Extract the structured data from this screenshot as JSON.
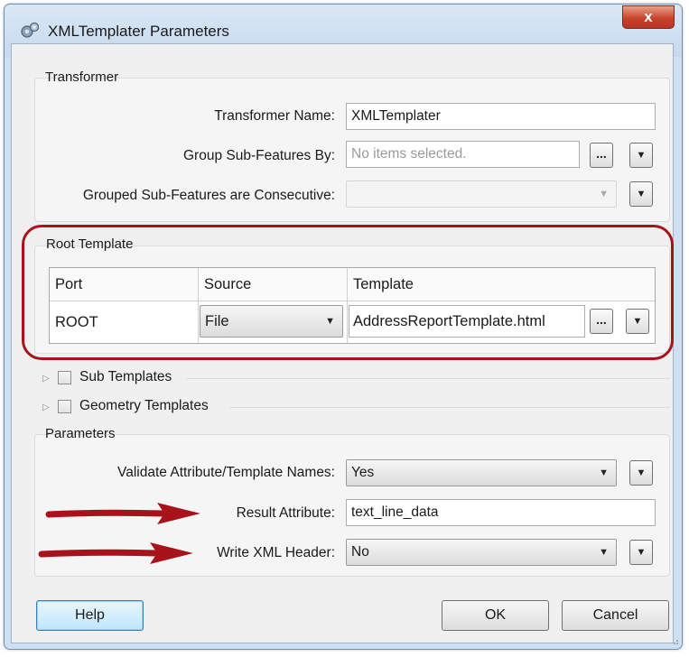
{
  "window": {
    "title": "XMLTemplater Parameters",
    "close_glyph": "x"
  },
  "transformer": {
    "group_title": "Transformer",
    "name_label": "Transformer Name:",
    "name_value": "XMLTemplater",
    "group_by_label": "Group Sub-Features By:",
    "group_by_placeholder": "No items selected.",
    "group_by_button": "...",
    "consecutive_label": "Grouped Sub-Features are Consecutive:",
    "consecutive_value": ""
  },
  "root_template": {
    "group_title": "Root Template",
    "columns": [
      "Port",
      "Source",
      "Template"
    ],
    "row": {
      "port": "ROOT",
      "source": "File",
      "template": "AddressReportTemplate.html",
      "browse_button": "..."
    }
  },
  "sections": {
    "sub_templates": "Sub Templates",
    "geometry_templates": "Geometry Templates"
  },
  "parameters": {
    "group_title": "Parameters",
    "validate_label": "Validate Attribute/Template Names:",
    "validate_value": "Yes",
    "result_label": "Result Attribute:",
    "result_value": "text_line_data",
    "xml_header_label": "Write XML Header:",
    "xml_header_value": "No"
  },
  "buttons": {
    "help": "Help",
    "ok": "OK",
    "cancel": "Cancel"
  },
  "colors": {
    "highlight": "#a8131b",
    "title_bar": "#cfe0f1",
    "close_button": "#c9442e"
  }
}
